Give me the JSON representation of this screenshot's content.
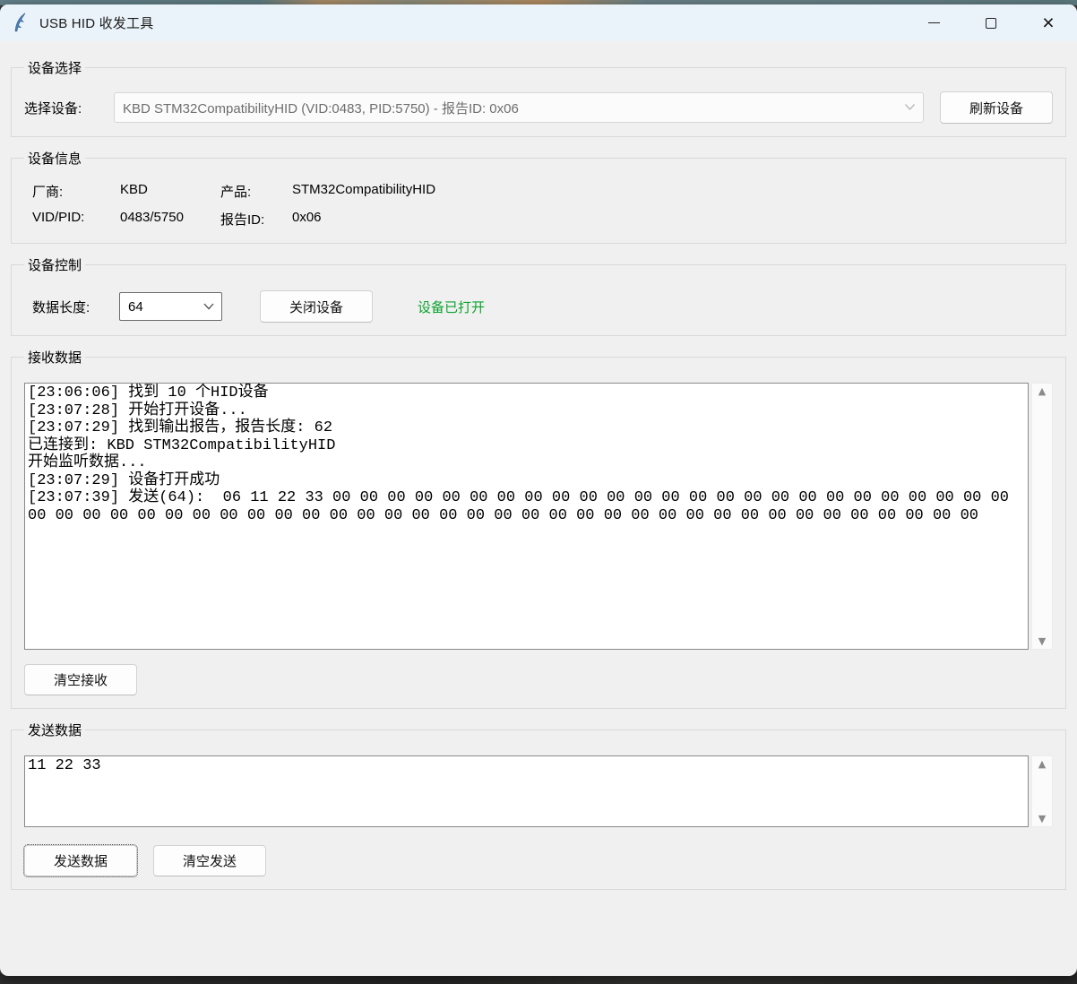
{
  "window": {
    "title": "USB HID 收发工具",
    "controls": {
      "close_glyph": "×"
    }
  },
  "icons": {
    "scroll_up": "▲",
    "scroll_down": "▼"
  },
  "device_selection": {
    "group_label": "设备选择",
    "select_label": "选择设备:",
    "device_value": "KBD STM32CompatibilityHID (VID:0483, PID:5750) - 报告ID: 0x06",
    "refresh_button": "刷新设备"
  },
  "device_info": {
    "group_label": "设备信息",
    "vendor_label": "厂商:",
    "vendor_value": "KBD",
    "product_label": "产品:",
    "product_value": "STM32CompatibilityHID",
    "vidpid_label": "VID/PID:",
    "vidpid_value": "0483/5750",
    "report_label": "报告ID:",
    "report_value": "0x06"
  },
  "device_control": {
    "group_label": "设备控制",
    "length_label": "数据长度:",
    "length_value": "64",
    "close_button": "关闭设备",
    "status_text": "设备已打开",
    "status_color": "#0ca32e"
  },
  "receive": {
    "group_label": "接收数据",
    "log": "[23:06:06] 找到 10 个HID设备\n[23:07:28] 开始打开设备...\n[23:07:29] 找到输出报告，报告长度: 62\n已连接到: KBD STM32CompatibilityHID\n开始监听数据...\n[23:07:29] 设备打开成功\n[23:07:39] 发送(64):  06 11 22 33 00 00 00 00 00 00 00 00 00 00 00 00 00 00 00 00 00 00 00 00 00 00 00 00 00 00 00 00 00 00 00 00 00 00 00 00 00 00 00 00 00 00 00 00 00 00 00 00 00 00 00 00 00 00 00 00 00 00 00 00",
    "clear_button": "清空接收"
  },
  "send": {
    "group_label": "发送数据",
    "input_value": "11 22 33",
    "send_button": "发送数据",
    "clear_button": "清空发送"
  }
}
